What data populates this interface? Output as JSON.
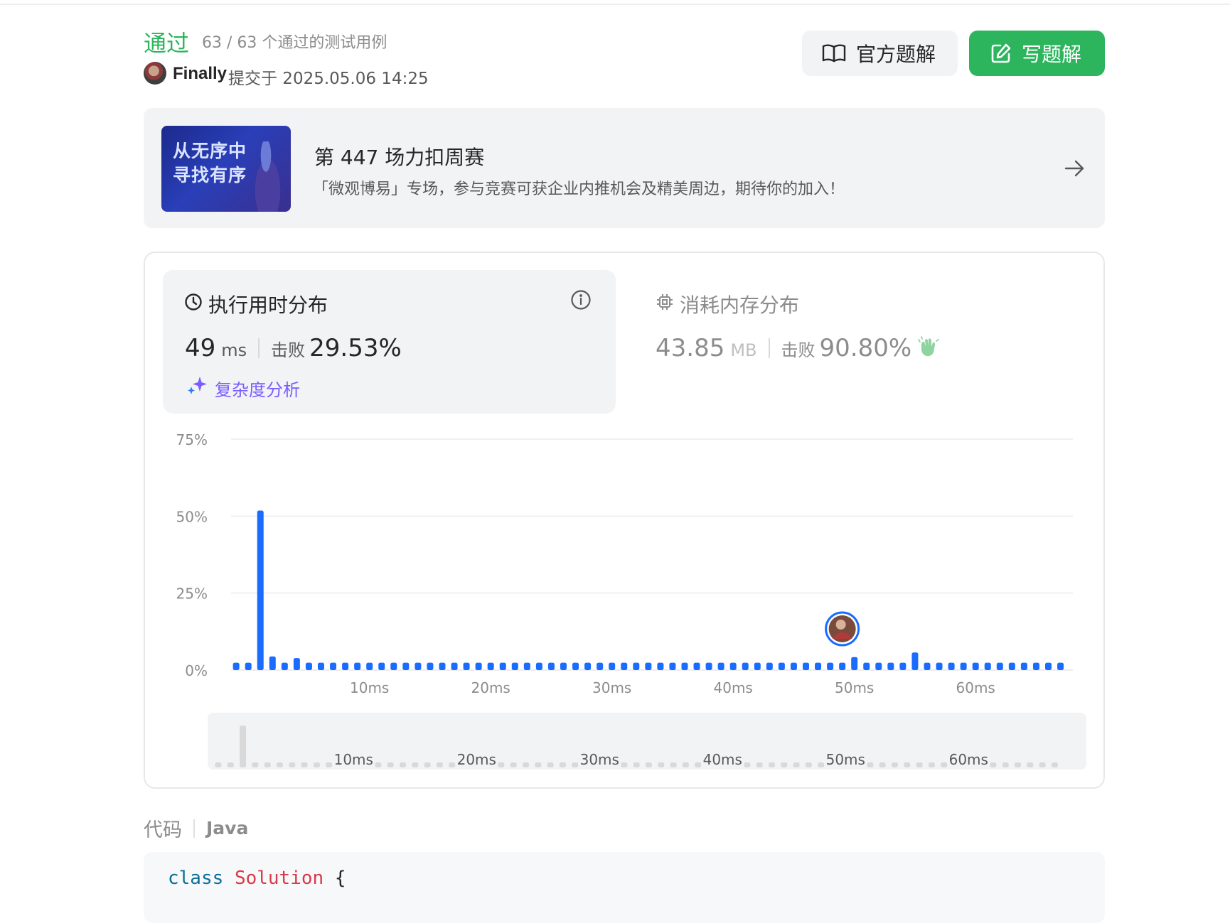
{
  "header": {
    "status": "通过",
    "cases": "63 / 63 个通过的测试用例",
    "user": "Finally",
    "submitted_at": "提交于 2025.05.06 14:25",
    "official_solution_label": "官方题解",
    "write_solution_label": "写题解"
  },
  "banner": {
    "image_text_line1": "从无序中",
    "image_text_line2": "寻找有序",
    "title": "第 447 场力扣周赛",
    "description": "「微观博易」专场，参与竞赛可获企业内推机会及精美周边，期待你的加入！"
  },
  "runtime": {
    "title": "执行用时分布",
    "value": "49",
    "unit": "ms",
    "beat_label": "击败",
    "beat_value": "29.53%",
    "complexity_label": "复杂度分析"
  },
  "memory": {
    "title": "消耗内存分布",
    "value": "43.85",
    "unit": "MB",
    "beat_label": "击败",
    "beat_value": "90.80%"
  },
  "chart_data": {
    "type": "bar",
    "title": "",
    "xlabel": "",
    "ylabel": "",
    "ylim": [
      0,
      75
    ],
    "y_ticks": [
      "75%",
      "50%",
      "25%",
      "0%"
    ],
    "x_ticks": [
      "10ms",
      "20ms",
      "30ms",
      "40ms",
      "50ms",
      "60ms"
    ],
    "x_tick_values": [
      10,
      20,
      30,
      40,
      50,
      60
    ],
    "x": [
      -1,
      0,
      1,
      2,
      3,
      4,
      5,
      6,
      7,
      8,
      9,
      10,
      11,
      12,
      13,
      14,
      15,
      16,
      17,
      18,
      19,
      20,
      21,
      22,
      23,
      24,
      25,
      26,
      27,
      28,
      29,
      30,
      31,
      32,
      33,
      34,
      35,
      36,
      37,
      38,
      39,
      40,
      41,
      42,
      43,
      44,
      45,
      46,
      47,
      48,
      49,
      50,
      51,
      52,
      53,
      54,
      55,
      56,
      57,
      58,
      59,
      60,
      61,
      62,
      63,
      64,
      65,
      66,
      67
    ],
    "values": [
      2.4,
      2.4,
      51.8,
      4.4,
      2.4,
      3.9,
      2.4,
      2.4,
      2.4,
      2.4,
      2.4,
      2.4,
      2.4,
      2.4,
      2.4,
      2.4,
      2.4,
      2.4,
      2.4,
      2.4,
      2.4,
      2.4,
      2.4,
      2.4,
      2.4,
      2.4,
      2.4,
      2.4,
      2.4,
      2.4,
      2.4,
      2.4,
      2.4,
      2.4,
      2.4,
      2.4,
      2.4,
      2.4,
      2.4,
      2.4,
      2.4,
      2.4,
      2.4,
      2.4,
      2.4,
      2.4,
      2.4,
      2.4,
      2.4,
      2.4,
      2.4,
      4.2,
      2.4,
      2.4,
      2.4,
      2.4,
      5.7,
      2.4,
      2.4,
      2.4,
      2.4,
      2.4,
      2.4,
      2.4,
      2.4,
      2.4,
      2.4,
      2.4,
      2.4
    ],
    "highlight_x": 49,
    "grid": true,
    "color": "#1a6cff"
  },
  "code": {
    "tab_label": "代码",
    "language": "Java",
    "line1_kw": "class",
    "line1_name": "Solution",
    "line1_brace": "{"
  },
  "colors": {
    "accent_green": "#2cb55d",
    "bar_blue": "#1a6cff",
    "complexity_purple": "#7a5cff"
  }
}
